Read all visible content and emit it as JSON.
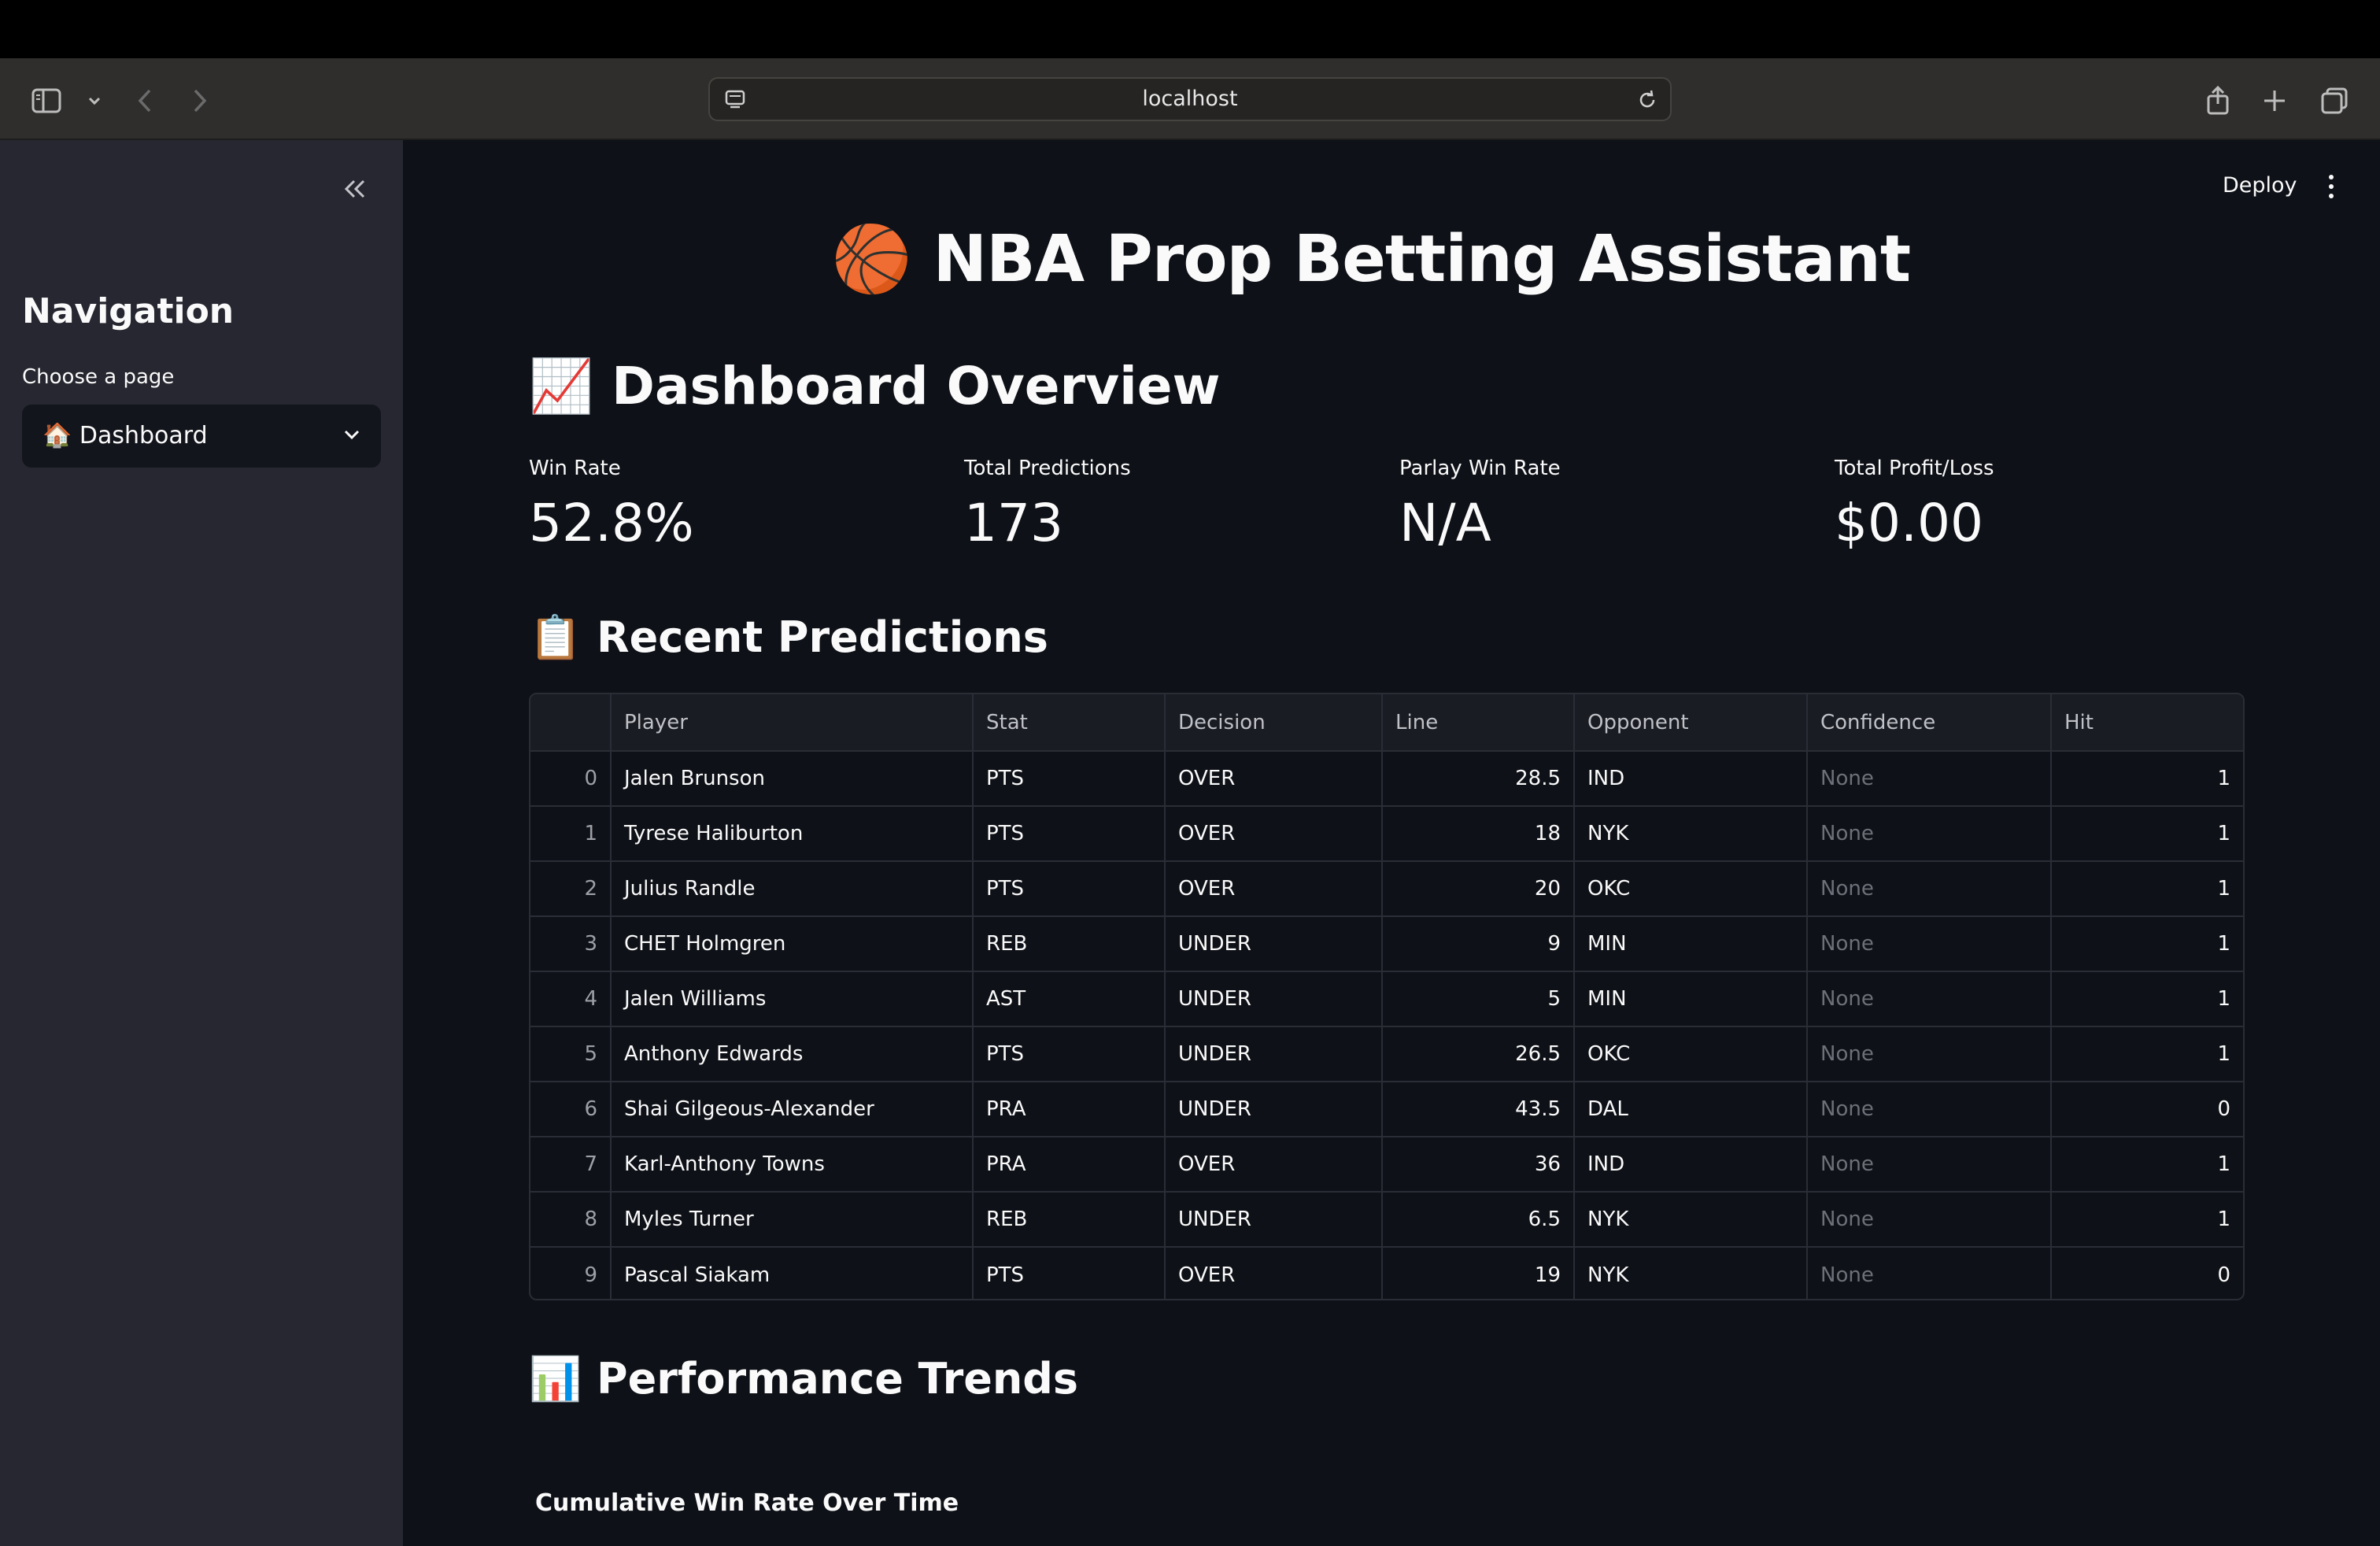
{
  "browser": {
    "url": "localhost"
  },
  "sidebar": {
    "title": "Navigation",
    "select_label": "Choose a page",
    "selected_page": "🏠 Dashboard"
  },
  "header": {
    "deploy_label": "Deploy"
  },
  "main": {
    "title": "🏀 NBA Prop Betting Assistant",
    "overview_heading": "📈 Dashboard Overview",
    "metrics": [
      {
        "label": "Win Rate",
        "value": "52.8%"
      },
      {
        "label": "Total Predictions",
        "value": "173"
      },
      {
        "label": "Parlay Win Rate",
        "value": "N/A"
      },
      {
        "label": "Total Profit/Loss",
        "value": "$0.00"
      }
    ],
    "recent_heading": "📋 Recent Predictions",
    "table": {
      "columns": [
        "",
        "Player",
        "Stat",
        "Decision",
        "Line",
        "Opponent",
        "Confidence",
        "Hit"
      ],
      "rows": [
        [
          "0",
          "Jalen Brunson",
          "PTS",
          "OVER",
          "28.5",
          "IND",
          "None",
          "1"
        ],
        [
          "1",
          "Tyrese Haliburton",
          "PTS",
          "OVER",
          "18",
          "NYK",
          "None",
          "1"
        ],
        [
          "2",
          "Julius Randle",
          "PTS",
          "OVER",
          "20",
          "OKC",
          "None",
          "1"
        ],
        [
          "3",
          "CHET Holmgren",
          "REB",
          "UNDER",
          "9",
          "MIN",
          "None",
          "1"
        ],
        [
          "4",
          "Jalen Williams",
          "AST",
          "UNDER",
          "5",
          "MIN",
          "None",
          "1"
        ],
        [
          "5",
          "Anthony Edwards",
          "PTS",
          "UNDER",
          "26.5",
          "OKC",
          "None",
          "1"
        ],
        [
          "6",
          "Shai Gilgeous-Alexander",
          "PRA",
          "UNDER",
          "43.5",
          "DAL",
          "None",
          "0"
        ],
        [
          "7",
          "Karl-Anthony Towns",
          "PRA",
          "OVER",
          "36",
          "IND",
          "None",
          "1"
        ],
        [
          "8",
          "Myles Turner",
          "REB",
          "UNDER",
          "6.5",
          "NYK",
          "None",
          "1"
        ],
        [
          "9",
          "Pascal Siakam",
          "PTS",
          "OVER",
          "19",
          "NYK",
          "None",
          "0"
        ]
      ]
    },
    "trends_heading": "📊 Performance Trends",
    "chart_title": "Cumulative Win Rate Over Time"
  }
}
